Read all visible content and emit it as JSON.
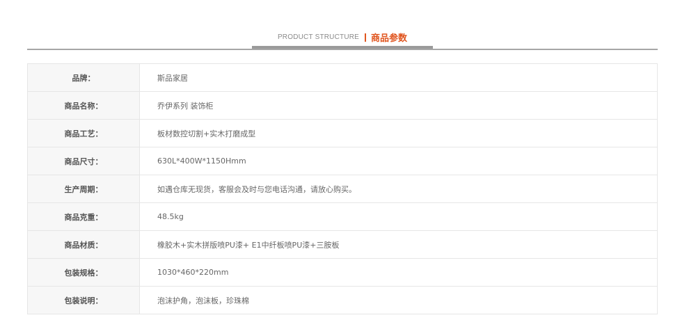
{
  "header": {
    "title_en": "PRODUCT STRUCTURE",
    "title_cn": "商品参数",
    "accent_color": "#e0551f"
  },
  "specs": [
    {
      "label": "品牌：",
      "value": "斯品家居"
    },
    {
      "label": "商品名称：",
      "value": "乔伊系列 装饰柜"
    },
    {
      "label": "商品工艺：",
      "value": "板材数控切割+实木打磨成型"
    },
    {
      "label": "商品尺寸：",
      "value": "630L*400W*1150Hmm"
    },
    {
      "label": "生产周期：",
      "value": "如遇仓库无现货，客服会及时与您电话沟通，请放心购买。"
    },
    {
      "label": "商品克重：",
      "value": "48.5kg"
    },
    {
      "label": "商品材质：",
      "value": "橡胶木+实木拼版喷PU漆+ E1中纤板喷PU漆+三胺板"
    },
    {
      "label": "包装规格：",
      "value": "1030*460*220mm"
    },
    {
      "label": "包装说明：",
      "value": "泡沫护角，泡沫板，珍珠棉"
    }
  ]
}
